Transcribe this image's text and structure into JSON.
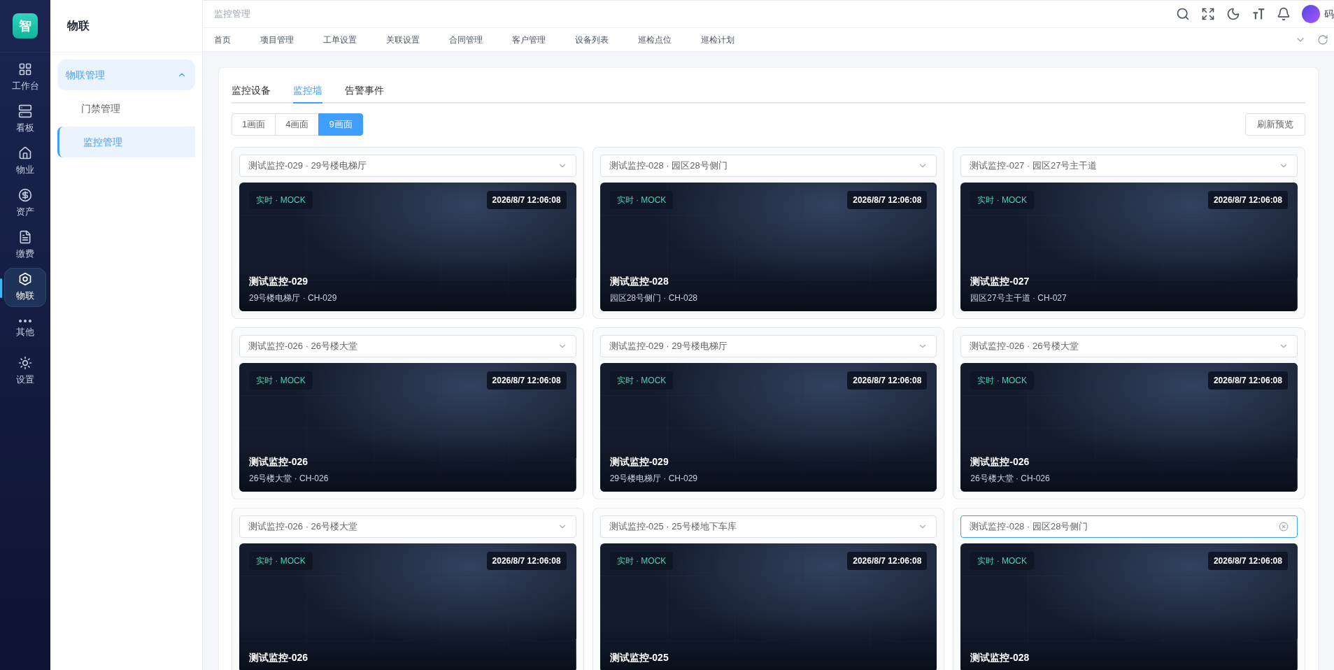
{
  "rail": {
    "logo": "智",
    "items": [
      {
        "label": "工作台",
        "selected": false
      },
      {
        "label": "看板",
        "selected": false
      },
      {
        "label": "物业",
        "selected": false
      },
      {
        "label": "资产",
        "selected": false
      },
      {
        "label": "缴费",
        "selected": false
      },
      {
        "label": "物联",
        "selected": true
      },
      {
        "label": "其他",
        "selected": false
      },
      {
        "label": "设置",
        "selected": false
      }
    ]
  },
  "sidebar": {
    "title": "物联",
    "groups": [
      {
        "label": "物联管理",
        "expanded": true,
        "children": [
          {
            "label": "门禁管理",
            "selected": false
          },
          {
            "label": "监控管理",
            "selected": true
          }
        ]
      }
    ]
  },
  "header": {
    "breadcrumb": "监控管理",
    "user": "码"
  },
  "page_tabs": [
    "首页",
    "项目管理",
    "工单设置",
    "关联设置",
    "合同管理",
    "客户管理",
    "设备列表",
    "巡检点位",
    "巡检计划"
  ],
  "content": {
    "tabs": [
      {
        "label": "监控设备",
        "selected": false
      },
      {
        "label": "监控墙",
        "selected": true
      },
      {
        "label": "告警事件",
        "selected": false
      }
    ],
    "layouts": [
      {
        "label": "1画面",
        "selected": false
      },
      {
        "label": "4画面",
        "selected": false
      },
      {
        "label": "9画面",
        "selected": true
      }
    ],
    "refresh_button": "刷新预览",
    "cells": [
      {
        "selector": "测试监控-029 · 29号楼电梯厅",
        "focused": false,
        "badge": "实时 · MOCK",
        "timestamp": "2026/8/7 12:06:08",
        "title": "测试监控-029",
        "subtitle": "29号楼电梯厅 · CH-029"
      },
      {
        "selector": "测试监控-028 · 园区28号侧门",
        "focused": false,
        "badge": "实时 · MOCK",
        "timestamp": "2026/8/7 12:06:08",
        "title": "测试监控-028",
        "subtitle": "园区28号侧门 · CH-028"
      },
      {
        "selector": "测试监控-027 · 园区27号主干道",
        "focused": false,
        "badge": "实时 · MOCK",
        "timestamp": "2026/8/7 12:06:08",
        "title": "测试监控-027",
        "subtitle": "园区27号主干道 · CH-027"
      },
      {
        "selector": "测试监控-026 · 26号楼大堂",
        "focused": false,
        "badge": "实时 · MOCK",
        "timestamp": "2026/8/7 12:06:08",
        "title": "测试监控-026",
        "subtitle": "26号楼大堂 · CH-026"
      },
      {
        "selector": "测试监控-029 · 29号楼电梯厅",
        "focused": false,
        "badge": "实时 · MOCK",
        "timestamp": "2026/8/7 12:06:08",
        "title": "测试监控-029",
        "subtitle": "29号楼电梯厅 · CH-029"
      },
      {
        "selector": "测试监控-026 · 26号楼大堂",
        "focused": false,
        "badge": "实时 · MOCK",
        "timestamp": "2026/8/7 12:06:08",
        "title": "测试监控-026",
        "subtitle": "26号楼大堂 · CH-026"
      },
      {
        "selector": "测试监控-026 · 26号楼大堂",
        "focused": false,
        "badge": "实时 · MOCK",
        "timestamp": "2026/8/7 12:06:08",
        "title": "测试监控-026"
      },
      {
        "selector": "测试监控-025 · 25号楼地下车库",
        "focused": false,
        "badge": "实时 · MOCK",
        "timestamp": "2026/8/7 12:06:08",
        "title": "测试监控-025"
      },
      {
        "selector": "测试监控-028 · 园区28号侧门",
        "focused": true,
        "badge": "实时 · MOCK",
        "timestamp": "2026/8/7 12:06:08",
        "title": "测试监控-028"
      }
    ]
  }
}
